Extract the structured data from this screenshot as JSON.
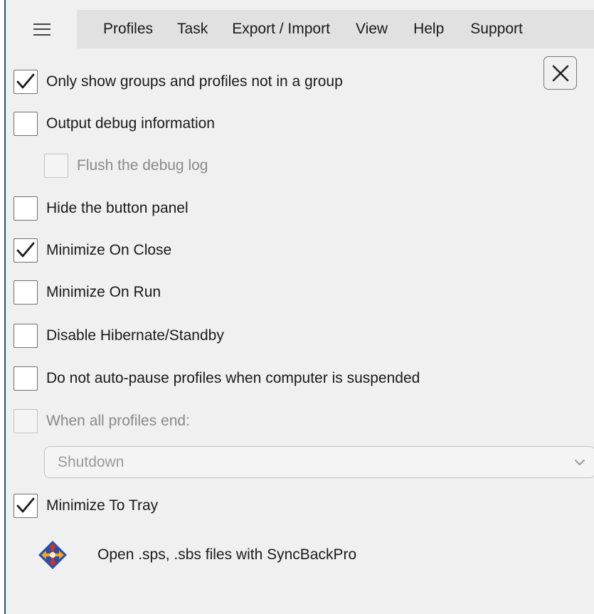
{
  "menu": {
    "items": [
      "Profiles",
      "Task",
      "Export / Import",
      "View",
      "Help",
      "Support"
    ]
  },
  "options": [
    {
      "label": "Only show groups and profiles not in a group",
      "checked": true,
      "enabled": true
    },
    {
      "label": "Output debug information",
      "checked": false,
      "enabled": true
    },
    {
      "label": "Flush the debug log",
      "checked": false,
      "enabled": false
    },
    {
      "label": "Hide the button panel",
      "checked": false,
      "enabled": true
    },
    {
      "label": "Minimize On Close",
      "checked": true,
      "enabled": true
    },
    {
      "label": "Minimize On Run",
      "checked": false,
      "enabled": true
    },
    {
      "label": "Disable Hibernate/Standby",
      "checked": false,
      "enabled": true
    },
    {
      "label": "Do not auto-pause profiles when computer is suspended",
      "checked": false,
      "enabled": true
    },
    {
      "label": "When all profiles end:",
      "checked": false,
      "enabled": false
    },
    {
      "label": "Minimize To Tray",
      "checked": true,
      "enabled": true
    }
  ],
  "end_action": {
    "value": "Shutdown",
    "enabled": false
  },
  "file_association": {
    "label": "Open .sps, .sbs files with SyncBackPro",
    "icon": "syncbackpro-logo-icon"
  },
  "icons": {
    "menu": "hamburger-menu-icon",
    "close": "close-icon",
    "check": "checkmark-icon",
    "dropdown": "chevron-down-icon"
  },
  "colors": {
    "menubar_background": "#e1e1e1",
    "window_background": "#f0f0f0",
    "logo_blue": "#2b4ea8",
    "logo_orange": "#f5a623",
    "logo_red": "#d9331f"
  }
}
